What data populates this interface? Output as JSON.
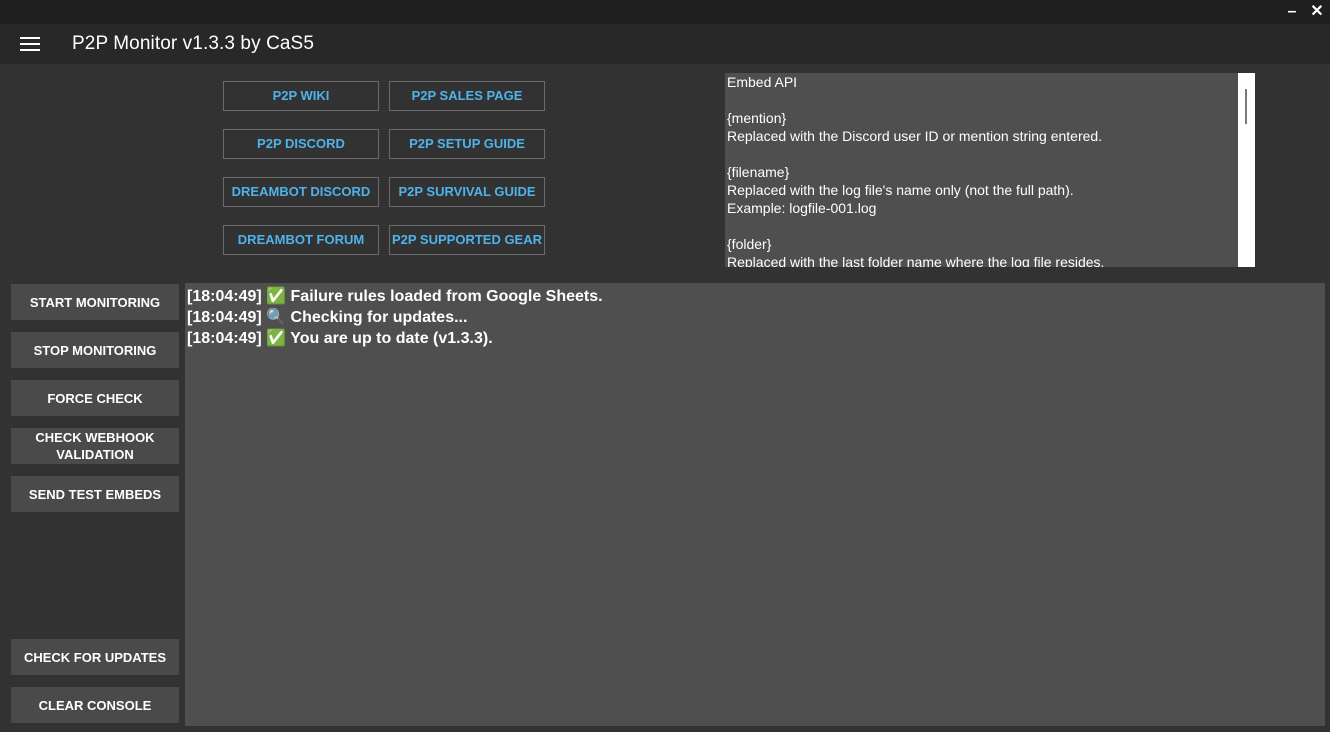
{
  "window": {
    "minimize_icon": "minimize-icon",
    "minimize_glyph": "–",
    "close_icon": "close-icon",
    "close_glyph": "✕"
  },
  "header": {
    "menu_icon": "hamburger-menu-icon",
    "title": "P2P Monitor v1.3.3 by CaS5"
  },
  "links": [
    {
      "label": "P2P WIKI"
    },
    {
      "label": "P2P SALES PAGE"
    },
    {
      "label": "P2P DISCORD"
    },
    {
      "label": "P2P SETUP GUIDE"
    },
    {
      "label": "DREAMBOT DISCORD"
    },
    {
      "label": "P2P SURVIVAL GUIDE"
    },
    {
      "label": "DREAMBOT FORUM"
    },
    {
      "label": "P2P SUPPORTED GEAR"
    }
  ],
  "embed_panel": {
    "text": "Embed API\n\n{mention}\nReplaced with the Discord user ID or mention string entered.\n\n{filename}\nReplaced with the log file's name only (not the full path).\nExample: logfile-001.log\n\n{folder}\nReplaced with the last folder name where the log file resides."
  },
  "sidebar": {
    "buttons": [
      {
        "label": "START MONITORING"
      },
      {
        "label": "STOP MONITORING"
      },
      {
        "label": "FORCE CHECK"
      },
      {
        "label": "CHECK WEBHOOK VALIDATION"
      },
      {
        "label": "SEND TEST EMBEDS"
      }
    ],
    "bottom_buttons": [
      {
        "label": "CHECK FOR UPDATES"
      },
      {
        "label": "CLEAR CONSOLE"
      }
    ]
  },
  "console": {
    "lines": [
      {
        "text": "[18:04:49] ✅ Failure rules loaded from Google Sheets."
      },
      {
        "text": "[18:04:49] 🔍 Checking for updates..."
      },
      {
        "text": "[18:04:49] ✅ You are up to date (v1.3.3)."
      }
    ]
  },
  "colors": {
    "accent_link": "#4fb3ea",
    "background": "#323232",
    "panel": "#4f4f4f",
    "header": "#282828"
  }
}
